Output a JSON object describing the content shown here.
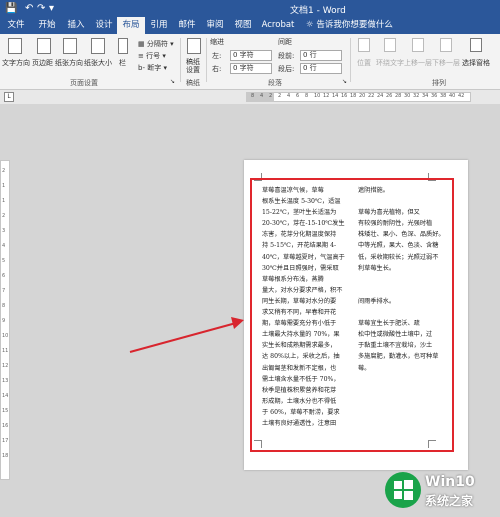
{
  "titlebar": {
    "save_icon": "save-icon",
    "undo_icon": "undo-icon",
    "redo_icon": "redo-icon",
    "customize_icon": "customize-arrow-icon",
    "title": "文档1 - Word"
  },
  "tabs": [
    "文件",
    "开始",
    "插入",
    "设计",
    "布局",
    "引用",
    "邮件",
    "审阅",
    "视图",
    "Acrobat"
  ],
  "active_tab": "布局",
  "tell_me": "告诉我你想要做什么",
  "ribbon": {
    "text_direction": "文字方向",
    "margins": "页边距",
    "orientation": "纸张方向",
    "size": "纸张大小",
    "columns": "栏",
    "breaks": "分隔符",
    "line_numbers": "行号",
    "hyphenation": "断字",
    "page_setup_group": "页面设置",
    "draft_paper": "稿纸设置",
    "draft_group": "稿纸",
    "indent_label": "缩进",
    "indent_left_label": "左:",
    "indent_left_value": "0 字符",
    "indent_right_label": "右:",
    "indent_right_value": "0 字符",
    "spacing_label": "间距",
    "spacing_before_label": "段前:",
    "spacing_before_value": "0 行",
    "spacing_after_label": "段后:",
    "spacing_after_value": "0 行",
    "paragraph_group": "段落",
    "position": "位置",
    "wrap_text": "环绕文字",
    "bring_forward": "上移一层",
    "send_backward": "下移一层",
    "selection_pane": "选择窗格",
    "arrange_group": "排列"
  },
  "ruler_ticks": [
    "8",
    "4",
    "2",
    "2",
    "4",
    "6",
    "8",
    "10",
    "12",
    "14",
    "16",
    "18",
    "20",
    "22",
    "24",
    "26",
    "28",
    "30",
    "32",
    "34",
    "36",
    "38",
    "40",
    "42"
  ],
  "vruler_ticks": [
    "2",
    "1",
    "1",
    "2",
    "3",
    "4",
    "5",
    "6",
    "7",
    "8",
    "9",
    "10",
    "11",
    "12",
    "13",
    "14",
    "15",
    "16",
    "17",
    "18"
  ],
  "column1": [
    "草莓喜温凉气候，草莓",
    "根系生长温度 5-30℃，适温",
    "15-22℃，茎叶生长适温为",
    "20-30℃，芽在-15-10℃发生",
    "冻害，花芽分化期温度保持",
    "持 5-15℃，开花结果期 4-",
    "40℃，草莓越夏时，气温高于",
    "30℃并且日照强时，需采取",
    "草莓根系分布浅，蒸腾",
    "量大，对水分要求严格，积不",
    "同生长期，草莓对水分的要",
    "求又稍有不同，早春和开花",
    "期，草莓需要充分有小低于",
    "土壤最大持水量的 70%，果",
    "实生长和成熟期需求最多，",
    "达 80%以上，采收之后，抽",
    "出匍匐茎和发新不定根，也",
    "需土壤含水量不低于 70%，",
    "秋季是植株积累营养和花芽",
    "形成期，土壤水分也不得低",
    "于 60%，草莓不耐涝，要求",
    "土壤有良好通透性，注意田"
  ],
  "column2": [
    "遮阴措施。",
    "",
    "草莓为喜光植物，但又",
    "有较强的耐阴性，光强时植",
    "株矮壮、果小、色深、品质好。",
    "中等光照，果大、色淡、含糖",
    "低，采收期较长；光照过弱不",
    "利草莓生长。",
    "",
    "",
    "间雨季排水。",
    "",
    "草莓宜生长于肥沃、疏",
    "松中性或微酸性土壤中，过",
    "于黏重土壤不宜栽培，沙土",
    "多施腐肥，勤灌水，也可种草",
    "莓。"
  ],
  "watermark": {
    "brand": "Win10",
    "sub": "系统之家",
    "logo_icon": "windows-logo-icon"
  }
}
